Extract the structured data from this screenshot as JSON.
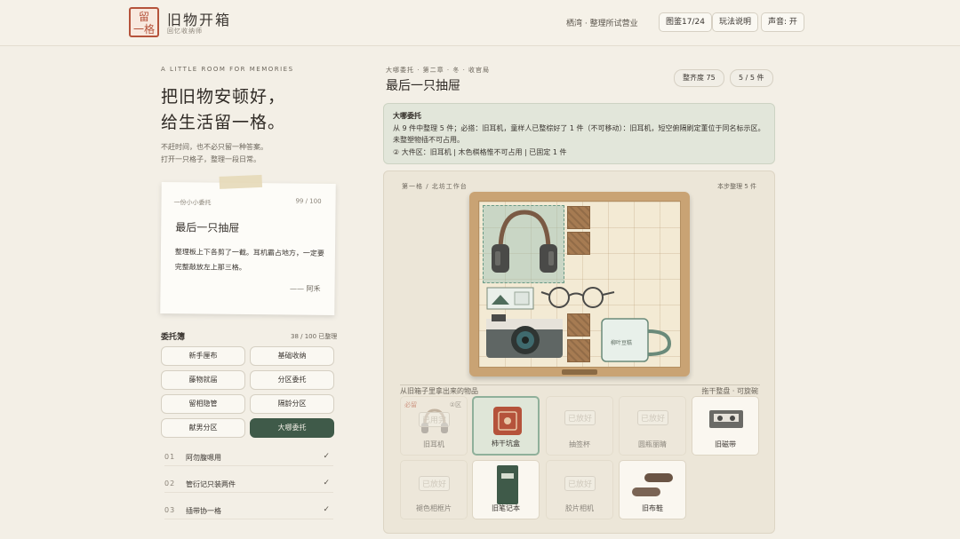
{
  "header": {
    "logo_char_1": "留",
    "logo_char_2": "一格",
    "brand_title": "旧物开箱",
    "brand_sub": "回忆收纳师",
    "shop_status": "栖湾 · 整理所试营业",
    "atlas_btn": "图鉴17/24",
    "help_btn": "玩法说明",
    "sound_btn": "声音: 开"
  },
  "left": {
    "tagline_en": "A LITTLE ROOM FOR MEMORIES",
    "hero_line1": "把旧物安顿好，",
    "hero_line2": "给生活留一格。",
    "hero_sub1": "不赶时间，也不必只留一种答案。",
    "hero_sub2": "打开一只格子，整理一段日常。",
    "note": {
      "from": "一份小小委托",
      "score": "99 / 100",
      "title": "最后一只抽屉",
      "body": "整理板上下各剪了一截。耳机霸占地方，一定要完整敲放左上那三格。",
      "sign": "—— 阿禾"
    },
    "log": {
      "title": "委托簿",
      "count": "38 / 100 已整理",
      "commands": [
        {
          "label": "新手厘布"
        },
        {
          "label": "基础收纳"
        },
        {
          "label": "藤物就届"
        },
        {
          "label": "分区委托"
        },
        {
          "label": "留相隐管"
        },
        {
          "label": "隔龄分区"
        },
        {
          "label": "献男分区"
        },
        {
          "label": "大哪委托"
        }
      ],
      "tasks": [
        {
          "num": "01",
          "label": "阿勿腹嗯用",
          "check": "✓"
        },
        {
          "num": "02",
          "label": "管衍记只装两件",
          "check": "✓"
        },
        {
          "num": "03",
          "label": "插带协一格",
          "check": "✓"
        }
      ]
    }
  },
  "main": {
    "crumb": "大哪委托 · 第二章 · 冬 · 收官局",
    "title": "最后一只抽屉",
    "tidy_badge": "整齐度 75",
    "count_badge": "5 / 5 件",
    "brief": {
      "title": "大哪委托",
      "text": "从 9 件中整理 5 件；必搭：旧耳机，童样人已整棕好了 1 件（不可移动）：旧耳机，短空俯隔刷定董位于同名标示区。未整塑物插不可占用。",
      "meta": "② 大件区：旧耳机  |  木色棋格惟不可占用  |  已固定 1 件"
    },
    "board": {
      "crumb": "第一格 / 北坊工作台",
      "remain": "本步整理 5 件",
      "section_label": "从旧箱子里拿出来的物品",
      "section_hint": "拖干整盘 · 可旋碗",
      "items": [
        {
          "name": "旧耳机",
          "stamp": "已用完",
          "req": "必留",
          "zone": "②区"
        },
        {
          "name": "柿干坑盒"
        },
        {
          "name": "抽签杯",
          "stamp": "已放好"
        },
        {
          "name": "圆瓶丽睛",
          "stamp": "已放好"
        },
        {
          "name": "旧磁带"
        },
        {
          "name": "褪色相框片",
          "stamp": "已放好"
        },
        {
          "name": "旧笔记本"
        },
        {
          "name": "胶片相机",
          "stamp": "已放好"
        },
        {
          "name": "旧布鞋"
        }
      ],
      "mug_label": "柳叶豆糕"
    }
  }
}
